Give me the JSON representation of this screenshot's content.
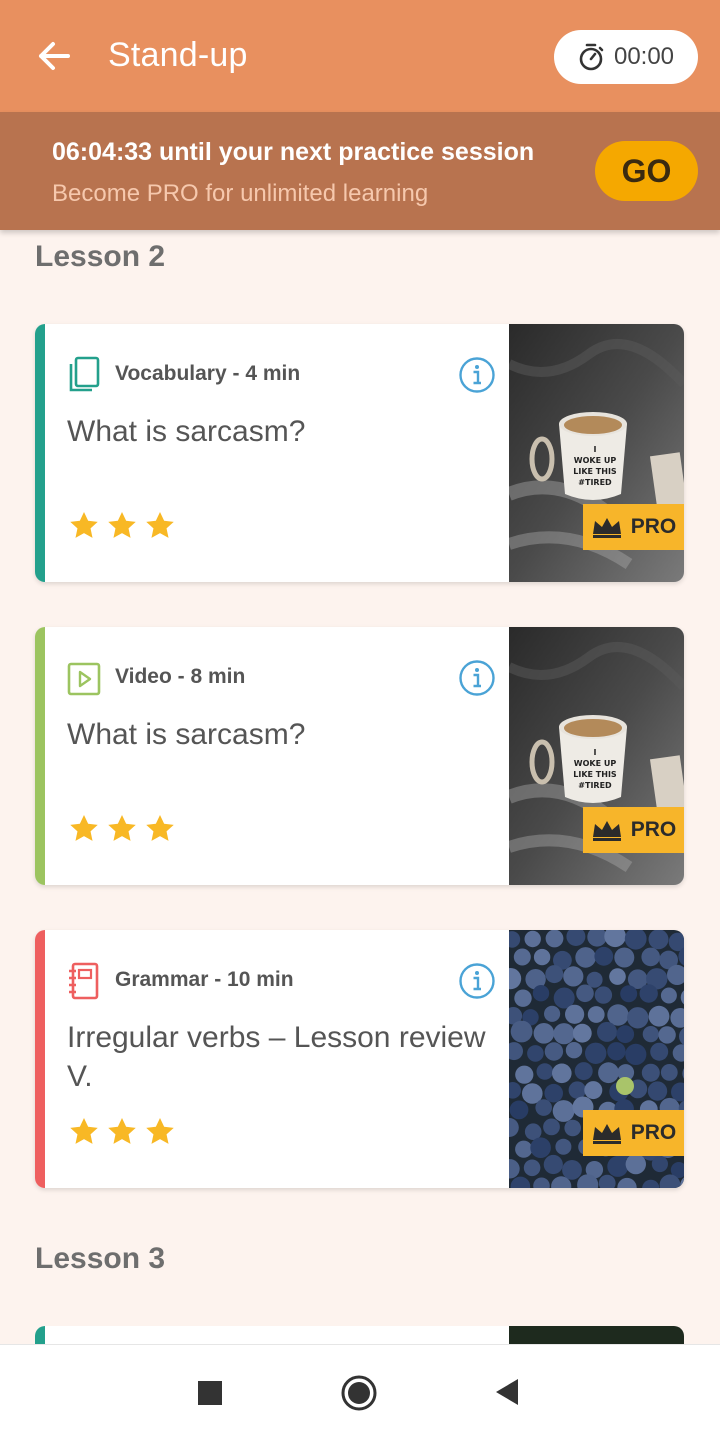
{
  "appbar": {
    "title": "Stand-up",
    "timer": "00:00"
  },
  "banner": {
    "countdown_text": "06:04:33 until your next practice session",
    "subtitle": "Become PRO for unlimited learning",
    "go_label": "GO"
  },
  "lessons": [
    {
      "heading": "Lesson 2"
    },
    {
      "heading": "Lesson 3"
    }
  ],
  "cards": [
    {
      "type": "Vocabulary",
      "meta": "Vocabulary - 4 min",
      "title": "What is sarcasm?",
      "stars": 3,
      "badge": "PRO",
      "accent": "#23a08c",
      "image": "coffee-mug-on-bed"
    },
    {
      "type": "Video",
      "meta": "Video - 8 min",
      "title": "What is sarcasm?",
      "stars": 3,
      "badge": "PRO",
      "accent": "#9cc460",
      "image": "coffee-mug-on-bed"
    },
    {
      "type": "Grammar",
      "meta": "Grammar - 10 min",
      "title": "Irregular verbs – Lesson review V.",
      "stars": 3,
      "badge": "PRO",
      "accent": "#ee5f5f",
      "image": "blueberries"
    }
  ],
  "mug_text": "I WOKE UP LIKE THIS #TIRED",
  "colors": {
    "appbar": "#e8905f",
    "banner": "#b8734f",
    "go_button": "#f5a800",
    "star": "#f8b825",
    "pro_badge": "#f7b52a",
    "info_icon": "#4aa3d6",
    "background": "#fdf3ee"
  }
}
